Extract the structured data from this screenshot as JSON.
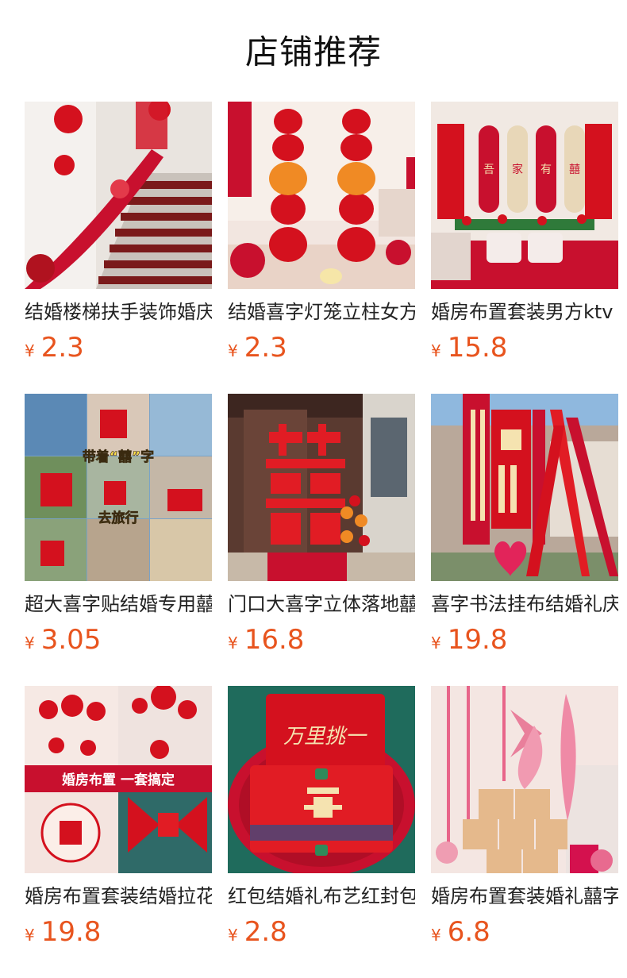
{
  "header": {
    "title": "店铺推荐"
  },
  "currency": "¥",
  "products": [
    {
      "name": "结婚楼梯扶手装饰婚庆",
      "price": "2.3",
      "icon": "stair-decoration-image"
    },
    {
      "name": "结婚喜字灯笼立柱女方",
      "price": "2.3",
      "icon": "lantern-pillar-image"
    },
    {
      "name": "婚房布置套装男方ktv",
      "price": "15.8",
      "icon": "bedroom-decoration-image",
      "overlay": [
        "吾",
        "家",
        "有",
        "囍"
      ]
    },
    {
      "name": "超大喜字贴结婚专用囍",
      "price": "3.05",
      "icon": "travel-collage-image",
      "overlay": [
        "带着“囍”字",
        "去旅行"
      ]
    },
    {
      "name": "门口大喜字立体落地囍",
      "price": "16.8",
      "icon": "door-xi-image"
    },
    {
      "name": "喜字书法挂布结婚礼庆",
      "price": "19.8",
      "icon": "calligraphy-banner-image"
    },
    {
      "name": "婚房布置套装结婚拉花",
      "price": "19.8",
      "icon": "wedding-room-set-image",
      "overlay": [
        "婚房布置 一套搞定"
      ]
    },
    {
      "name": "红包结婚礼布艺红封包",
      "price": "2.8",
      "icon": "red-envelope-image",
      "overlay": [
        "万里挑一"
      ]
    },
    {
      "name": "婚房布置套装婚礼囍字",
      "price": "6.8",
      "icon": "pink-decor-image"
    }
  ]
}
